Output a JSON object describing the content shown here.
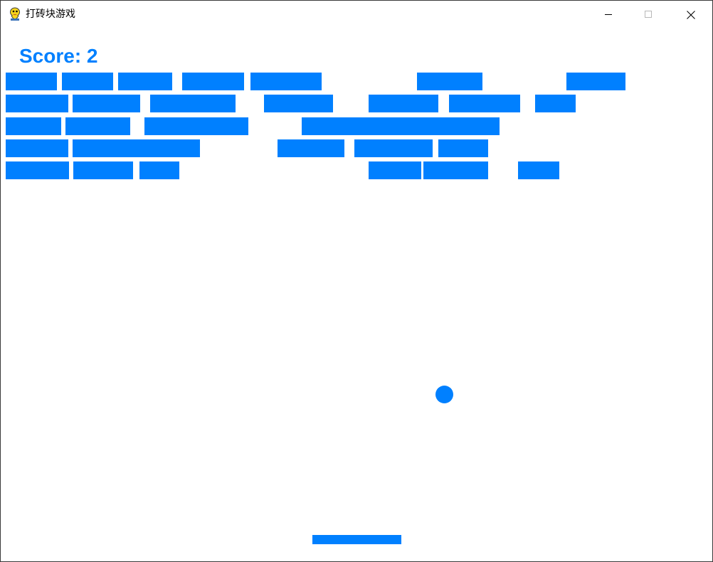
{
  "window": {
    "title": "打砖块游戏",
    "app_icon": "pygame-snake-icon",
    "controls": [
      "minimize-icon",
      "maximize-icon",
      "close-icon"
    ]
  },
  "game": {
    "score_text": "Score: 2",
    "score_value": 2,
    "colors": {
      "brick": "#0080ff",
      "ball": "#0080ff",
      "paddle": "#0080ff",
      "score": "#0080ff",
      "background": "#ffffff"
    },
    "brick_rows": 5,
    "bricks_remaining": 28
  }
}
